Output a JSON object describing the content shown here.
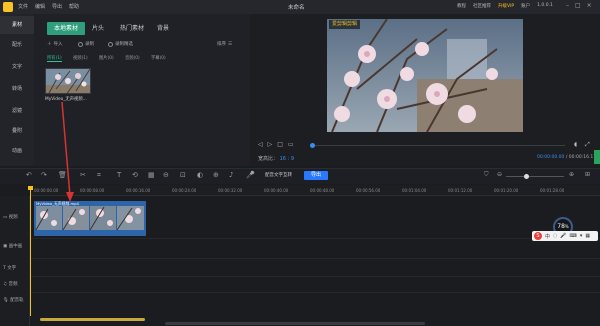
{
  "app": {
    "title": "未命名",
    "menu": [
      "文件",
      "编辑",
      "导出",
      "帮助"
    ],
    "right_menu": [
      "教程",
      "社区推荐",
      "升级VIP",
      "账户"
    ],
    "version": "1.0.0.1"
  },
  "rail": {
    "items": [
      "素材",
      "配乐",
      "文字",
      "转场",
      "滤镜",
      "叠附",
      "动画"
    ]
  },
  "media": {
    "tabs": [
      "本地素材",
      "片头",
      "热门素材",
      "背景"
    ],
    "options": {
      "import": "导入",
      "record": "录制",
      "screen_record": "录制精选",
      "sort": "排序"
    },
    "categories": [
      "所有(1)",
      "视频(1)",
      "图片(0)",
      "音频(0)",
      "字幕(0)"
    ],
    "file": {
      "name": "MyVideo_无声视频..."
    }
  },
  "preview": {
    "watermark": "爱剪辑剪辑",
    "ratio_label": "宽高比：",
    "ratio_value": "16 : 9",
    "current_time": "00:00:00.00",
    "total_time": "/ 00:00:16.17"
  },
  "toolbar": {
    "tts_label": "配音文字互转",
    "export_label": "导出",
    "zoom_percent": 35
  },
  "ruler": {
    "ticks": [
      "00:00:00.00",
      "00:00:08.00",
      "00:00:16.00",
      "00:00:24.00",
      "00:00:32.00",
      "00:00:40.00",
      "00:00:48.00",
      "00:00:56.00",
      "00:01:04.00",
      "00:01:12.00",
      "00:01:20.00",
      "00:01:28.00"
    ]
  },
  "tracks": {
    "labels": [
      "视频",
      "画中画",
      "文字",
      "音频",
      "配音轨"
    ],
    "clip_title": "MyVideo_无声视频.mp4"
  },
  "overlay": {
    "perf_value": "78",
    "perf_unit": "%",
    "sogou": "中"
  },
  "colors": {
    "accent_green": "#2e9f7a",
    "accent_blue": "#2979ff",
    "playhead": "#f0c419",
    "clip": "#2e64a8"
  }
}
